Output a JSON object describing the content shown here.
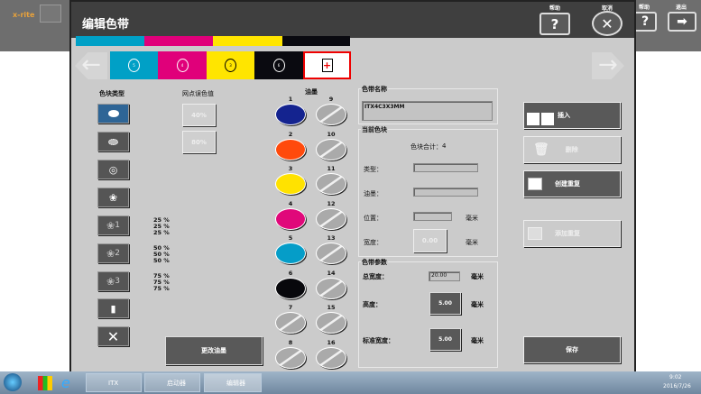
{
  "app": {
    "logo": "x-rite",
    "help_label": "帮助",
    "exit_label": "退出",
    "help_icon": "?",
    "exit_icon": "➡"
  },
  "dialog": {
    "title": "编辑色带",
    "help_label": "帮助",
    "cancel_label": "取消",
    "help_icon": "?",
    "cancel_icon": "✕"
  },
  "colorbar": {
    "segments": [
      {
        "color": "#00a0c6"
      },
      {
        "color": "#e0007a"
      },
      {
        "color": "#ffe500"
      },
      {
        "color": "#0a0a10"
      }
    ]
  },
  "patches": [
    {
      "label": "5",
      "color": "#00a0c6",
      "ring": "#fff"
    },
    {
      "label": "4",
      "color": "#e0007a",
      "ring": "#fff"
    },
    {
      "label": "3",
      "color": "#ffe500",
      "ring": "#000"
    },
    {
      "label": "6",
      "color": "#0a0a10",
      "ring": "#fff"
    }
  ],
  "add_patch_icon": "+",
  "patch_type": {
    "header": "色块类型",
    "pct_groups": [
      [
        "25 %",
        "25 %",
        "25 %"
      ],
      [
        "50 %",
        "50 %",
        "50 %"
      ],
      [
        "75 %",
        "75 %",
        "75 %"
      ]
    ],
    "subs": [
      "1",
      "2",
      "3"
    ]
  },
  "tint": {
    "header": "网点误色值",
    "values": [
      "40%",
      "80%"
    ]
  },
  "inks": {
    "header": "油墨",
    "change_label": "更改油墨",
    "items": [
      {
        "n": "1",
        "color": "#14238f"
      },
      {
        "n": "2",
        "color": "#ff4a0c"
      },
      {
        "n": "3",
        "color": "#ffe200"
      },
      {
        "n": "4",
        "color": "#e0087a"
      },
      {
        "n": "5",
        "color": "#059dc8"
      },
      {
        "n": "6",
        "color": "#08080c"
      },
      {
        "n": "7",
        "color": ""
      },
      {
        "n": "8",
        "color": ""
      },
      {
        "n": "9",
        "color": ""
      },
      {
        "n": "10",
        "color": ""
      },
      {
        "n": "11",
        "color": ""
      },
      {
        "n": "12",
        "color": ""
      },
      {
        "n": "13",
        "color": ""
      },
      {
        "n": "14",
        "color": ""
      },
      {
        "n": "15",
        "color": ""
      },
      {
        "n": "16",
        "color": ""
      }
    ]
  },
  "name_group": {
    "legend": "色带名称",
    "value": "ITX4C3X3MM"
  },
  "current": {
    "legend": "当前色块",
    "count_label": "色块合计：",
    "count": "4",
    "type_label": "类型：",
    "ink_label": "油墨：",
    "pos_label": "位置：",
    "width_label": "宽度：",
    "width_value": "0.00",
    "unit": "毫米"
  },
  "params": {
    "legend": "色带参数",
    "total_label": "总宽度：",
    "total_value": "20.00",
    "height_label": "高度：",
    "height_value": "5.00",
    "std_label": "标准宽度：",
    "std_value": "5.00",
    "unit": "毫米"
  },
  "actions": {
    "insert": "插入",
    "delete": "删除",
    "create_repeat": "创建重复",
    "add_repeat": "添加重复",
    "save": "保存"
  },
  "taskbar": {
    "items": [
      "ITX",
      "启动器",
      "编辑器"
    ],
    "time": "9:02",
    "date": "2016/7/26"
  }
}
